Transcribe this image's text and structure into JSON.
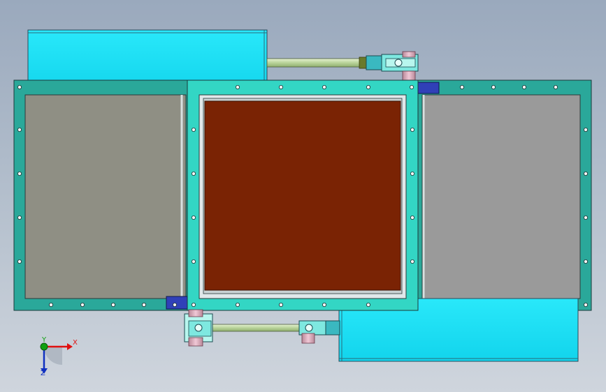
{
  "triad": {
    "x_label": "X",
    "y_label": "Y",
    "z_label": "Z",
    "x_color": "#e01010",
    "y_color": "#10a010",
    "z_color": "#1030c0"
  },
  "colors": {
    "background_top": "#9aa9bd",
    "background_bottom": "#cfd5dd",
    "frame_teal": "#2aa89a",
    "flange_cyan": "#33d6c4",
    "actuator_cyan": "#1ee4f6",
    "damper_blade": "#7a2304",
    "left_panel": "#8f8f84",
    "right_panel": "#9a9a9a",
    "rod": "#c8ddb0",
    "bracket_blue": "#3040b8",
    "pivot_pink": "#d9a8b8"
  }
}
